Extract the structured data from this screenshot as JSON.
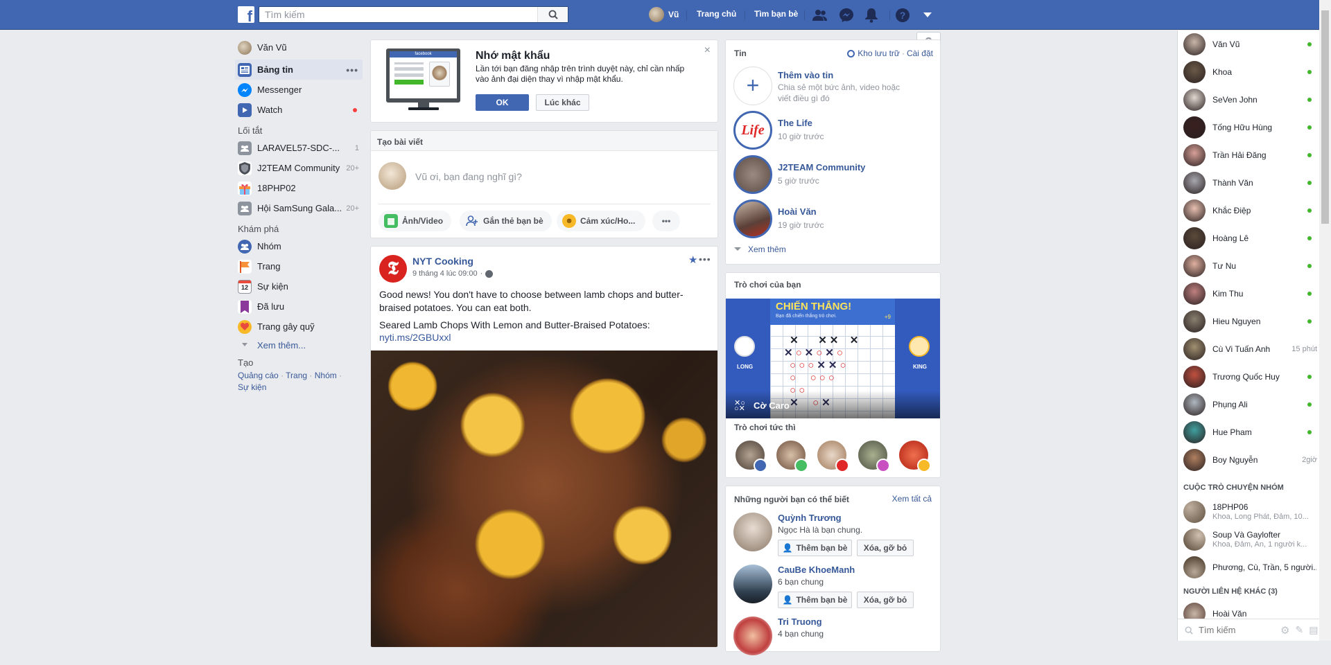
{
  "topbar": {
    "search_placeholder": "Tìm kiếm",
    "user": "Vũ",
    "home": "Trang chủ",
    "find_friends": "Tìm bạn bè"
  },
  "leftnav": {
    "profile": "Văn Vũ",
    "main": [
      {
        "label": "Bảng tin"
      },
      {
        "label": "Messenger"
      },
      {
        "label": "Watch"
      }
    ],
    "shortcuts_title": "Lối tắt",
    "shortcuts": [
      {
        "label": "LARAVEL57-SDC-...",
        "count": "1"
      },
      {
        "label": "J2TEAM Community",
        "count": "20+"
      },
      {
        "label": "18PHP02",
        "count": ""
      },
      {
        "label": "Hội SamSung Gala...",
        "count": "20+"
      }
    ],
    "explore_title": "Khám phá",
    "explore": [
      {
        "label": "Nhóm"
      },
      {
        "label": "Trang"
      },
      {
        "label": "Sự kiện"
      },
      {
        "label": "Đã lưu"
      },
      {
        "label": "Trang gây quỹ"
      }
    ],
    "see_more": "Xem thêm...",
    "create_title": "Tạo",
    "create_links": [
      "Quảng cáo",
      "Trang",
      "Nhóm",
      "Sự kiện"
    ]
  },
  "remember": {
    "title": "Nhớ mật khẩu",
    "body": "Lần tới bạn đăng nhập trên trình duyệt này, chỉ cần nhấp vào ảnh đại diện thay vì nhập mật khẩu.",
    "ok": "OK",
    "later": "Lúc khác",
    "illustration_brand": "facebook"
  },
  "composer": {
    "title": "Tạo bài viết",
    "placeholder": "Vũ ơi, bạn đang nghĩ gì?",
    "actions": [
      "Ảnh/Video",
      "Gắn thẻ bạn bè",
      "Cảm xúc/Ho..."
    ]
  },
  "post": {
    "author": "NYT Cooking",
    "time": "9 tháng 4 lúc 09:00",
    "text1": "Good news! You don't have to choose between lamb chops and butter-braised potatoes. You can eat both.",
    "text2": "Seared Lamb Chops With Lemon and Butter-Braised Potatoes:",
    "link": "nyti.ms/2GBUxxl"
  },
  "stories": {
    "title": "Tin",
    "archive": "Kho lưu trữ",
    "settings": "Cài đặt",
    "add_title": "Thêm vào tin",
    "add_desc": "Chia sẻ một bức ảnh, video hoặc viết điều gì đó",
    "items": [
      {
        "name": "The Life",
        "time": "10 giờ trước",
        "logo": "Life"
      },
      {
        "name": "J2TEAM Community",
        "time": "5 giờ trước"
      },
      {
        "name": "Hoài Văn",
        "time": "19 giờ trước"
      }
    ],
    "see_more": "Xem thêm"
  },
  "games": {
    "title": "Trò chơi của bạn",
    "banner_title": "CHIẾN THẮNG!",
    "banner_sub": "Bạn đã chiến thắng trò chơi.",
    "score": "+9",
    "player_left": "LONG",
    "player_right": "KING",
    "game_name": "Cờ Caro",
    "instant_title": "Trò chơi tức thì"
  },
  "pymk": {
    "title": "Những người bạn có thể biết",
    "see_all": "Xem tất cả",
    "add_label": "Thêm bạn bè",
    "remove_label": "Xóa, gỡ bỏ",
    "people": [
      {
        "name": "Quỳnh Trương",
        "mutual": "Ngọc Hà là bạn chung."
      },
      {
        "name": "CauBe KhoeManh",
        "mutual": "6 bạn chung"
      },
      {
        "name": "Tri Truong",
        "mutual": "4 bạn chung"
      }
    ]
  },
  "chat": {
    "contacts": [
      {
        "name": "Văn Vũ",
        "time": ""
      },
      {
        "name": "Khoa",
        "time": ""
      },
      {
        "name": "SeVen John",
        "time": ""
      },
      {
        "name": "Tống Hữu Hùng",
        "time": ""
      },
      {
        "name": "Trần Hải Đăng",
        "time": ""
      },
      {
        "name": "Thành Văn",
        "time": ""
      },
      {
        "name": "Khắc Điệp",
        "time": ""
      },
      {
        "name": "Hoàng Lê",
        "time": ""
      },
      {
        "name": "Tư Nu",
        "time": ""
      },
      {
        "name": "Kim Thu",
        "time": ""
      },
      {
        "name": "Hieu Nguyen",
        "time": ""
      },
      {
        "name": "Cù Vi Tuấn Anh",
        "time": "15 phút"
      },
      {
        "name": "Trương Quốc Huy",
        "time": ""
      },
      {
        "name": "Phụng Ali",
        "time": ""
      },
      {
        "name": "Hue Pham",
        "time": ""
      },
      {
        "name": "Boy Nguyễn",
        "time": "2giờ"
      }
    ],
    "groups_title": "CUỘC TRÒ CHUYỆN NHÓM",
    "groups": [
      {
        "name": "18PHP06",
        "members": "Khoa, Long Phát, Đảm, 10..."
      },
      {
        "name": "Soup Và Gaylofter",
        "members": "Khoa, Đảm, An, 1 người k..."
      },
      {
        "name": "Phương, Cù, Trần, 5 người...",
        "members": ""
      }
    ],
    "others_title": "NGƯỜI LIÊN HỆ KHÁC (3)",
    "others": [
      {
        "name": "Hoài Văn"
      }
    ],
    "search_placeholder": "Tìm kiếm"
  },
  "colors": {
    "brand": "#4267b2",
    "online": "#42b72a",
    "page_bg": "#e9ebee"
  }
}
